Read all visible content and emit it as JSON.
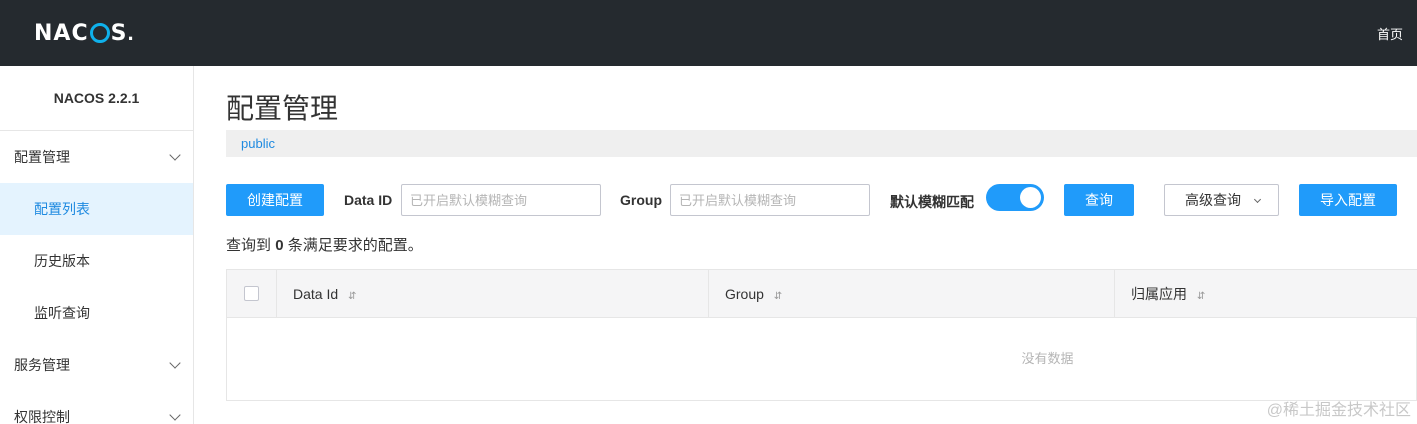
{
  "header": {
    "logo_pre": "NAC",
    "logo_post": "S",
    "logo_dot": ".",
    "home_link": "首页"
  },
  "sidebar": {
    "version": "NACOS 2.2.1",
    "groups": [
      {
        "label": "配置管理",
        "items": [
          "配置列表",
          "历史版本",
          "监听查询"
        ]
      },
      {
        "label": "服务管理"
      },
      {
        "label": "权限控制"
      }
    ],
    "active_item": "配置列表"
  },
  "main": {
    "title": "配置管理",
    "namespace": "public",
    "create_button": "创建配置",
    "data_id_label": "Data ID",
    "data_id_placeholder": "已开启默认模糊查询",
    "group_label": "Group",
    "group_placeholder": "已开启默认模糊查询",
    "fuzzy_label": "默认模糊匹配",
    "fuzzy_enabled": true,
    "query_button": "查询",
    "advanced_query": "高级查询",
    "import_button": "导入配置",
    "result_prefix": "查询到",
    "result_count": "0",
    "result_suffix": "条满足要求的配置。"
  },
  "table": {
    "columns": [
      "Data Id",
      "Group",
      "归属应用"
    ],
    "sort_glyph": "⇵",
    "empty_text": "没有数据"
  },
  "watermark": "@稀土掘金技术社区",
  "colors": {
    "topbar": "#252a2f",
    "primary": "#209bfa",
    "logo_accent": "#0fb1ec",
    "active_bg": "#e4f3fe"
  }
}
